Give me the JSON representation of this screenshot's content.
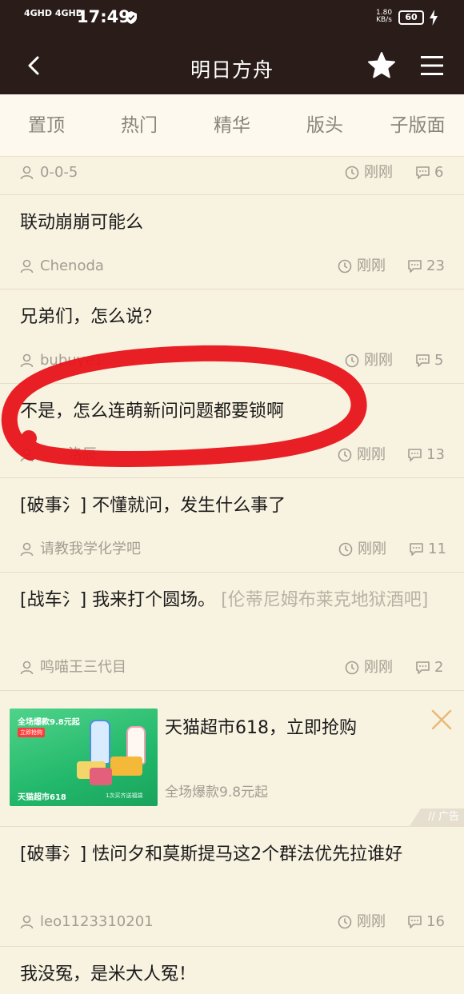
{
  "status_bar": {
    "signal1": "4GHD",
    "signal2": "4GHD",
    "time": "17:49",
    "speed_value": "1.80",
    "speed_unit": "KB/s",
    "battery": "60"
  },
  "header": {
    "title": "明日方舟"
  },
  "tabs": [
    "置顶",
    "热门",
    "精华",
    "版头",
    "子版面"
  ],
  "posts": [
    {
      "title": "",
      "author": "0-0-5",
      "time": "刚刚",
      "comments": "6"
    },
    {
      "title": "联动崩崩可能么",
      "author": "Chenoda",
      "time": "刚刚",
      "comments": "23"
    },
    {
      "title": "兄弟们，怎么说？",
      "author": "bubuye1",
      "time": "刚刚",
      "comments": "5"
    },
    {
      "title": "不是，怎么连萌新问问题都要锁啊",
      "author": "洛辰",
      "time": "刚刚",
      "comments": "13"
    },
    {
      "tag": "[破事氵]",
      "title": "不懂就问，发生什么事了",
      "author": "请教我学化学吧",
      "time": "刚刚",
      "comments": "11"
    },
    {
      "tag": "[战车氵]",
      "title": "我来打个圆场。",
      "board": "[伦蒂尼姆布莱克地狱酒吧]",
      "author": "鸣喵王三代目",
      "time": "刚刚",
      "comments": "2"
    },
    {
      "tag": "[破事氵]",
      "title": "怯问夕和莫斯提马这2个群法优先拉谁好",
      "author": "leo1123310201",
      "time": "刚刚",
      "comments": "16"
    },
    {
      "title": "我没冤，是米大人冤！"
    }
  ],
  "ad": {
    "title": "天猫超市618，立即抢购",
    "subtitle": "全场爆款9.8元起",
    "label": "广告",
    "image_text_top": "全场爆款9.8元起",
    "image_badge": "立即抢购",
    "image_text_bottom": "天猫超市618",
    "image_text_small": "1次买齐送福袋"
  },
  "colors": {
    "header_bg": "#2a1d19",
    "page_bg": "#f8f2e0",
    "annotation": "#e8131b"
  }
}
